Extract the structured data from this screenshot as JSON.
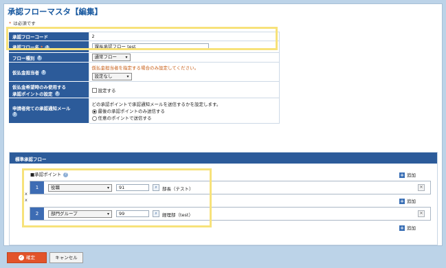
{
  "title": "承認フローマスタ【編集】",
  "required_note": {
    "star": "*",
    "text": "は必須です"
  },
  "form": {
    "code": {
      "label": "承認フローコード",
      "value": "2"
    },
    "name": {
      "label": "承認フロー名",
      "star": "*",
      "value": "課長承認フロー test"
    },
    "type": {
      "label": "フロー種別",
      "selected": "通常フロー"
    },
    "advance": {
      "label": "仮払金担当者",
      "note": "仮払金担当者を指定する場合のみ設定してください。",
      "selected": "設定なし"
    },
    "advance_only": {
      "label_line1": "仮払金希望時のみ使用する",
      "label_line2": "承認ポイントの設定",
      "checkbox_label": "設定する"
    },
    "notify": {
      "label": "申請者宛ての承認通知メール",
      "desc": "どの承認ポイントで承認通知メールを送信するかを設定します。",
      "options": [
        "最後の承認ポイントのみ送信する",
        "任意のポイントで送信する"
      ]
    }
  },
  "flow": {
    "header": "標準承認フロー",
    "points_label": "■承認ポイント",
    "add_label": "追加",
    "side_marks": [
      "x",
      "x"
    ],
    "steps": [
      {
        "num": "1",
        "type": "役職",
        "code": "91",
        "name": "部長（テスト）"
      },
      {
        "num": "2",
        "type": "部門グループ",
        "code": "99",
        "name": "経理部（test）"
      }
    ]
  },
  "buttons": {
    "ok": "確定",
    "cancel": "キャンセル"
  },
  "icons": {
    "help": "question-icon",
    "search": "search-icon",
    "delete": "close-icon",
    "add": "plus-icon",
    "confirm": "check-icon"
  },
  "colors": {
    "header_bg": "#2c5b9a",
    "title": "#1a5aa0",
    "required": "#ff7a45",
    "ok_button": "#e2532a",
    "highlight": "#f7e27a"
  }
}
